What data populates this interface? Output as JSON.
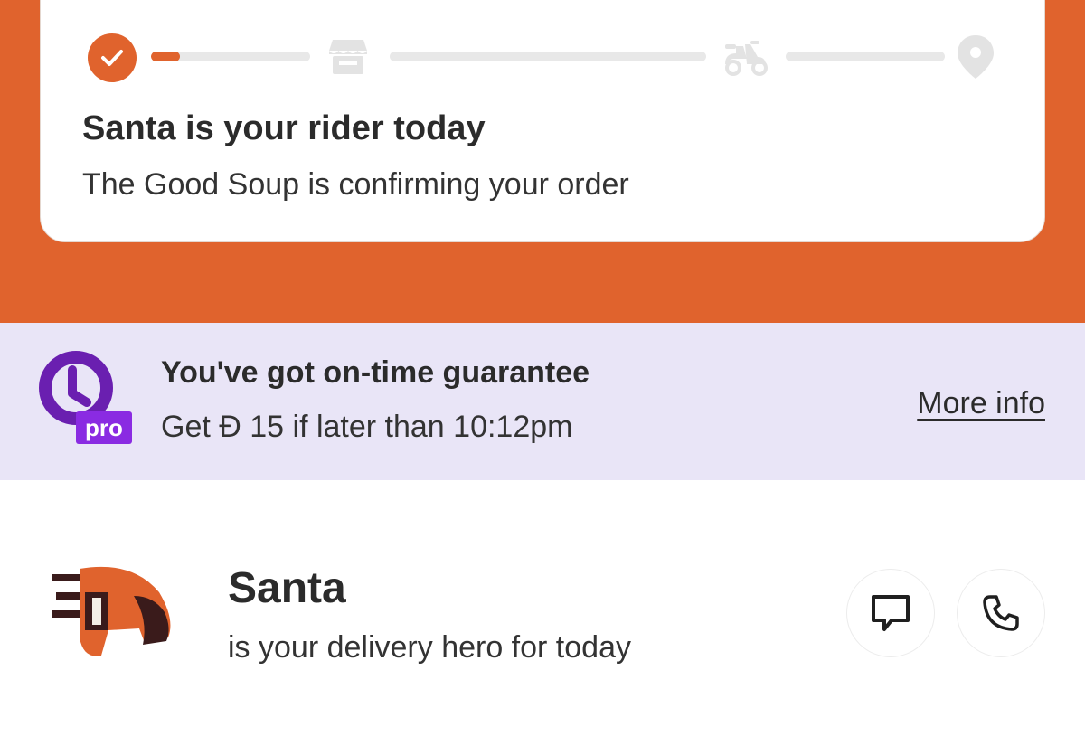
{
  "order_status": {
    "title": "Santa is your rider today",
    "subtitle": "The Good Soup is confirming your order",
    "progress": {
      "steps": [
        "check-icon",
        "store-icon",
        "scooter-icon",
        "location-pin-icon"
      ],
      "current_step": 1,
      "current_segment_fill": 0.18,
      "active_color": "#e0632d",
      "inactive_color": "#e8e8e8"
    }
  },
  "guarantee": {
    "badge_label": "pro",
    "title": "You've got on-time guarantee",
    "subtitle": "Get Đ 15 if later than 10:12pm",
    "link_label": "More info",
    "background_color": "#e9e5f7",
    "badge_color": "#6a1fb0"
  },
  "rider": {
    "name": "Santa",
    "subtitle": "is your delivery hero for today",
    "actions": [
      "chat-icon",
      "phone-icon"
    ]
  },
  "colors": {
    "brand": "#e0632d",
    "text": "#2b2b2b"
  }
}
